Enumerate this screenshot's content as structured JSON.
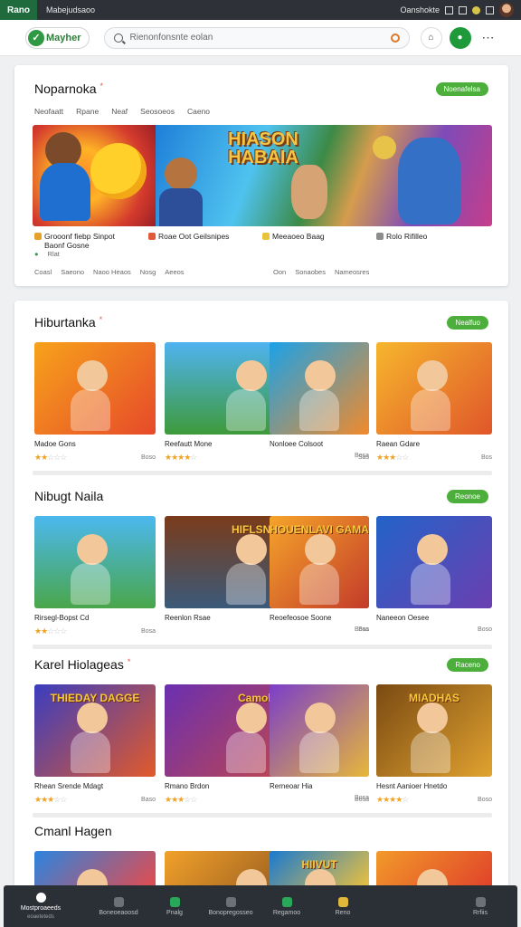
{
  "status_bar": {
    "tab": "Rano",
    "title": "Mabejudsaoo",
    "right_text": "Oanshokte"
  },
  "header": {
    "logo_text": "Mayher",
    "search_placeholder": "Rienonfonsnte eolan"
  },
  "featured": {
    "title": "Noparnoka",
    "see_all": "Noenafelsa",
    "tabs": [
      "Neofaatt",
      "Rpane",
      "Neaf",
      "Seosoeos",
      "Caeno"
    ],
    "hero_title": "HIASON HABAIA",
    "items": [
      {
        "name": "Grooonf fiebp Sinpot",
        "sub": "Baonf Gosne",
        "color": "#e6a12a"
      },
      {
        "name": "Roae Oot Geilsnipes",
        "sub": "",
        "color": "#e05a3a"
      },
      {
        "name": "Meeaoeo Baag",
        "sub": "",
        "color": "#e8c33a"
      },
      {
        "name": "Rolo Rifilleo",
        "sub": "",
        "color": "#8d8d8d"
      }
    ],
    "meta_badge": "Rlat",
    "meta_left": [
      "Coasl",
      "Saeono",
      "Naoo Heaos",
      "Nosg",
      "Aeeos"
    ],
    "meta_right": [
      "Oon",
      "Sonaobes",
      "Nameosres"
    ]
  },
  "sections": [
    {
      "title": "Hiburtanka",
      "see_all": "Nealfuo",
      "tiles": [
        {
          "name": "Madoe Gons",
          "rating": 2,
          "count": "Boso"
        },
        {
          "name": "Reefautt Mone",
          "rating": 4,
          "count": "Sas"
        },
        {
          "name": "Nonloee Colsoot",
          "rating": 0,
          "count": "Bosa"
        },
        {
          "name": "Raean Gdare",
          "rating": 3,
          "count": "Bos"
        }
      ]
    },
    {
      "title": "Nibugt Naila",
      "see_all": "Reonoe",
      "tiles": [
        {
          "name": "Rirsegl-Bopst Cd",
          "rating": 2,
          "count": "Bosa"
        },
        {
          "name": "Reenlon Rsae",
          "rating": 0,
          "count": "Bosa"
        },
        {
          "name": "Reoefeosoe Soone",
          "rating": 0,
          "count": "Sas"
        },
        {
          "name": "Naneeon Oesee",
          "rating": 0,
          "count": "Boso"
        }
      ]
    },
    {
      "title": "Karel Hiolageas",
      "see_all": "Raceno",
      "tiles": [
        {
          "name": "Rhean Srende Mdagt",
          "rating": 3,
          "count": "Baso"
        },
        {
          "name": "Rmano Brdon",
          "rating": 3,
          "count": "Bosa"
        },
        {
          "name": "Rerneoar Hia",
          "rating": 0,
          "count": "Bosa"
        },
        {
          "name": "Hesnt Aanioer Hnetdo",
          "rating": 4,
          "count": "Boso"
        }
      ]
    },
    {
      "title": "Cmanl Hagen",
      "see_all": "",
      "tiles": [
        {
          "name": "",
          "rating": 0,
          "count": ""
        },
        {
          "name": "",
          "rating": 0,
          "count": ""
        },
        {
          "name": "",
          "rating": 0,
          "count": ""
        },
        {
          "name": "",
          "rating": 0,
          "count": ""
        }
      ]
    }
  ],
  "thumb_labels": {
    "s1t1": "HIFLSNBBOS",
    "s1t2": "HOUENLAVI GAMA",
    "s2t0": "THIEDAY DAGGE",
    "s2t1": "Camobulwi",
    "s2t3": "MIADHAS",
    "s3t2": "HIIVUT"
  },
  "bottom_nav": [
    {
      "label": "Mostproaeeds",
      "sub": "eoaeteteds"
    },
    {
      "label": "Boneoeaoosd",
      "sub": ""
    },
    {
      "label": "Pnalg",
      "sub": ""
    },
    {
      "label": "Bonopregosseo",
      "sub": ""
    },
    {
      "label": "Regamoo",
      "sub": ""
    },
    {
      "label": "Reno",
      "sub": ""
    },
    {
      "label": "Rrfiis",
      "sub": ""
    }
  ],
  "colors": {
    "accent": "#4caf3b",
    "brand": "#2f9a43",
    "star": "#f0a324"
  }
}
